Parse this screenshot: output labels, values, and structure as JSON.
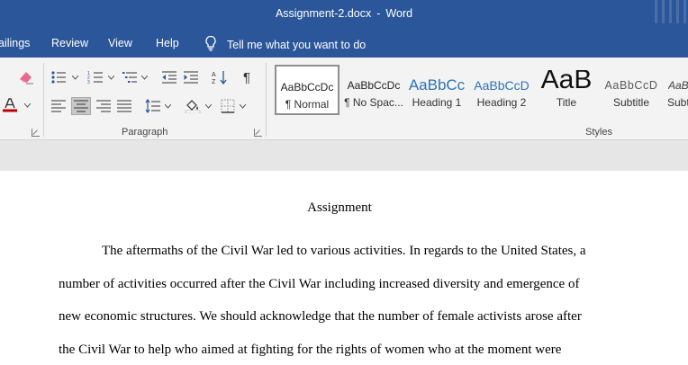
{
  "window": {
    "doc_name": "Assignment-2.docx",
    "separator": "-",
    "app_name": "Word"
  },
  "tabs": [
    "ailings",
    "Review",
    "View",
    "Help"
  ],
  "tell_me": "Tell me what you want to do",
  "ribbon": {
    "paragraph_label": "Paragraph",
    "styles_label": "Styles",
    "pilcrow": "¶",
    "font_color_letter": "A",
    "font_color": "#c00000",
    "styles": [
      {
        "sample": "AaBbCcDc",
        "name": "¶ Normal",
        "color": "#222222",
        "selected": true
      },
      {
        "sample": "AaBbCcDc",
        "name": "¶ No Spac...",
        "color": "#222222"
      },
      {
        "sample": "AaBbCc",
        "name": "Heading 1",
        "color": "#2e74b5"
      },
      {
        "sample": "AaBbCcD",
        "name": "Heading 2",
        "color": "#2e74b5"
      },
      {
        "sample": "AaB",
        "name": "Title",
        "color": "#111111"
      },
      {
        "sample": "AaBbCcD",
        "name": "Subtitle",
        "color": "#595959"
      },
      {
        "sample": "AaBbCcD",
        "name": "Subt",
        "color": "#404040"
      }
    ]
  },
  "document": {
    "title": "Assignment",
    "lines": [
      "The aftermaths of the Civil War led to various activities. In regards to the United States, a",
      "number of activities occurred after the Civil War including increased diversity and emergence of",
      "new economic structures. We should acknowledge that the number of female activists arose after",
      "the Civil War to help who aimed at fighting for the rights of women who at the moment were"
    ]
  },
  "colors": {
    "title_bar": "#2b579a",
    "ribbon": "#f3f3f3",
    "heading_blue": "#2e74b5"
  }
}
